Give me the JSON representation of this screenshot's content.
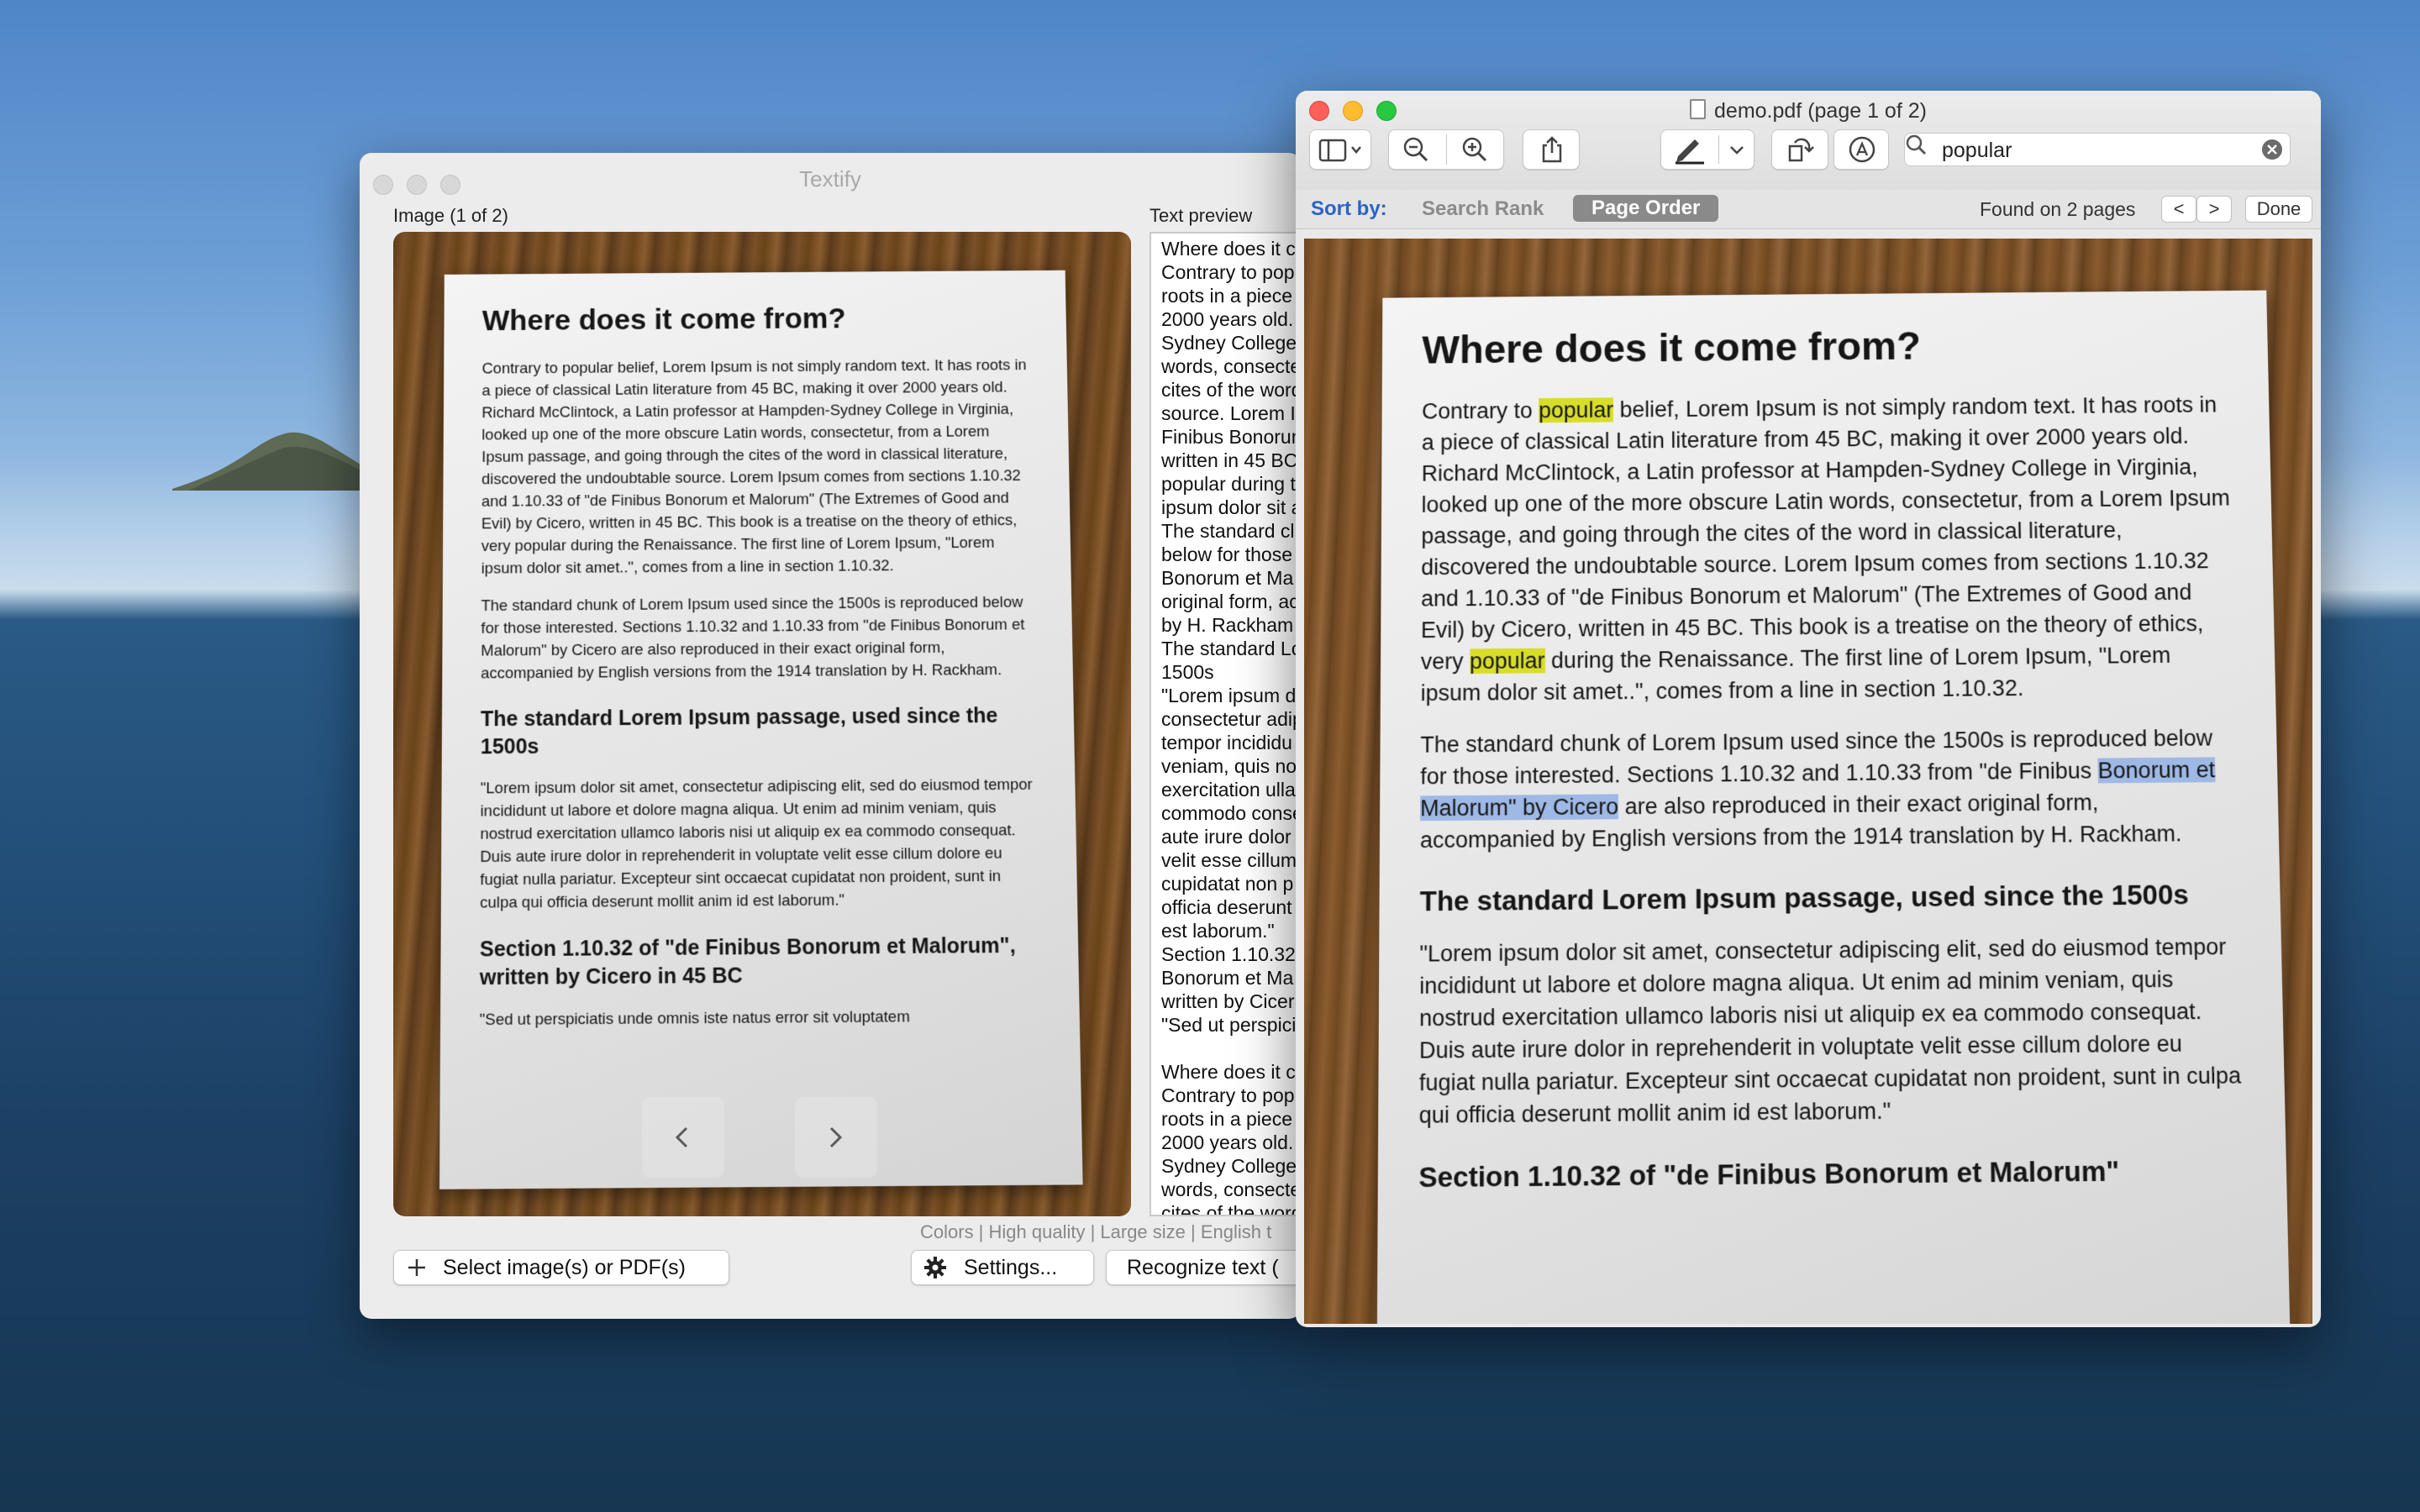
{
  "textify": {
    "title": "Textify",
    "image_label": "Image (1 of 2)",
    "preview_label": "Text preview",
    "status_line": "Colors | High quality | Large size | English t",
    "select_button": "Select image(s) or PDF(s)",
    "settings_button": "Settings...",
    "recognize_button": "Recognize text (",
    "page": {
      "heading": "Where does it come from?",
      "para1": "Contrary to popular belief, Lorem Ipsum is not simply random text. It has roots in a piece of classical Latin literature from 45 BC, making it over 2000 years old. Richard McClintock, a Latin professor at Hampden-Sydney College in Virginia, looked up one of the more obscure Latin words, consectetur, from a Lorem Ipsum passage, and going through the cites of the word in classical literature, discovered the undoubtable source. Lorem Ipsum comes from sections 1.10.32 and 1.10.33 of \"de Finibus Bonorum et Malorum\" (The Extremes of Good and Evil) by Cicero, written in 45 BC. This book is a treatise on the theory of ethics, very popular during the Renaissance. The first line of Lorem Ipsum, \"Lorem ipsum dolor sit amet..\", comes from a line in section 1.10.32.",
      "para2": "The standard chunk of Lorem Ipsum used since the 1500s is reproduced below for those interested. Sections 1.10.32 and 1.10.33 from \"de Finibus Bonorum et Malorum\" by Cicero are also reproduced in their exact original form, accompanied by English versions from the 1914 translation by H. Rackham.",
      "heading2": "The standard Lorem Ipsum passage, used since the 1500s",
      "para3": "\"Lorem ipsum dolor sit amet, consectetur adipiscing elit, sed do eiusmod tempor incididunt ut labore et dolore magna aliqua. Ut enim ad minim veniam, quis nostrud exercitation ullamco laboris nisi ut aliquip ex ea commodo consequat. Duis aute irure dolor in reprehenderit in voluptate velit esse cillum dolore eu fugiat nulla pariatur. Excepteur sint occaecat cupidatat non proident, sunt in culpa qui officia deserunt mollit anim id est laborum.\"",
      "heading3": "Section 1.10.32 of \"de Finibus Bonorum et Malorum\", written by Cicero in 45 BC",
      "para4": "\"Sed ut perspiciatis unde omnis iste natus error sit voluptatem"
    },
    "preview_lines": [
      "Where does it c",
      "Contrary to pop",
      "roots in a piece",
      "2000 years old.",
      "Sydney College",
      "words, consecte",
      "cites of the word",
      "source. Lorem I",
      "Finibus Bonorum",
      "written in 45 BC",
      "popular during t",
      "ipsum dolor sit a",
      "The standard cl",
      "below for those",
      "Bonorum et Ma",
      "original form, ac",
      "by H. Rackham",
      "The standard Lo",
      "1500s",
      "\"Lorem ipsum d",
      "consectetur adip",
      "tempor incididu",
      "veniam, quis no",
      "exercitation ulla",
      "commodo conse",
      "aute irure dolor",
      "velit esse cillum",
      "cupidatat non p",
      "officia deserunt",
      "est laborum.\"",
      "Section 1.10.32",
      "Bonorum et Ma",
      "written by Cicer",
      "\"Sed ut perspici",
      "",
      "Where does it c",
      "Contrary to pop",
      "roots in a piece",
      "2000 years old.",
      "Sydney College",
      "words, consecte",
      "cites of the word"
    ]
  },
  "preview": {
    "title": "demo.pdf (page 1 of 2)",
    "search_query": "popular",
    "sort_by": "Sort by:",
    "search_rank": "Search Rank",
    "page_order": "Page Order",
    "found": "Found on 2 pages",
    "prev": "<",
    "next": ">",
    "done": "Done",
    "page": {
      "heading": "Where does it come from?",
      "p1_a": "Contrary to ",
      "p1_hl1": "popular",
      "p1_b": " belief, Lorem Ipsum is not simply random text. It has roots in a piece of classical Latin literature from 45 BC, making it over 2000 years old. Richard McClintock, a Latin professor at Hampden-Sydney College in Virginia, looked up one of the more obscure Latin words, consectetur, from a Lorem Ipsum passage, and going through the cites of the word in classical literature, discovered the undoubtable source. Lorem Ipsum comes from sections 1.10.32 and 1.10.33 of \"de Finibus Bonorum et Malorum\" (The Extremes of Good and Evil) by Cicero, written in 45 BC. This book is a treatise on the theory of ethics, very ",
      "p1_hl2": "popular",
      "p1_c": " during the Renaissance. The first line of Lorem Ipsum, \"Lorem ipsum dolor sit amet..\", comes from a line in section 1.10.32.",
      "p2_a": "The standard chunk of Lorem Ipsum used since the 1500s is reproduced below for those interested. Sections 1.10.32 and 1.10.33 from \"de Finibus ",
      "p2_sel": "Bonorum et Malorum\" by Cicero",
      "p2_b": " are also reproduced in their exact original form, accompanied by English versions from the 1914 translation by H. Rackham.",
      "heading2": "The standard Lorem Ipsum passage, used since the 1500s",
      "para3": "\"Lorem ipsum dolor sit amet, consectetur adipiscing elit, sed do eiusmod tempor incididunt ut labore et dolore magna aliqua. Ut enim ad minim veniam, quis nostrud exercitation ullamco laboris nisi ut aliquip ex ea commodo consequat. Duis aute irure dolor in reprehenderit in voluptate velit esse cillum dolore eu fugiat nulla pariatur. Excepteur sint occaecat cupidatat non proident, sunt in culpa qui officia deserunt mollit anim id est laborum.\"",
      "heading3": "Section 1.10.32 of \"de Finibus Bonorum et Malorum\""
    }
  },
  "icons": [
    "sidebar-icon",
    "zoom-out-icon",
    "zoom-in-icon",
    "share-icon",
    "markup-pen-icon",
    "rotate-icon",
    "annotate-icon",
    "search-icon",
    "clear-icon",
    "plus-icon",
    "gear-icon",
    "chevron-left-icon",
    "chevron-right-icon"
  ],
  "colors": {
    "highlight_yellow": "#d8dd2a",
    "selection_blue": "#9fb9e6",
    "close_red": "#fe5f57",
    "minimize_yellow": "#febc2e",
    "zoom_green": "#28c840"
  }
}
